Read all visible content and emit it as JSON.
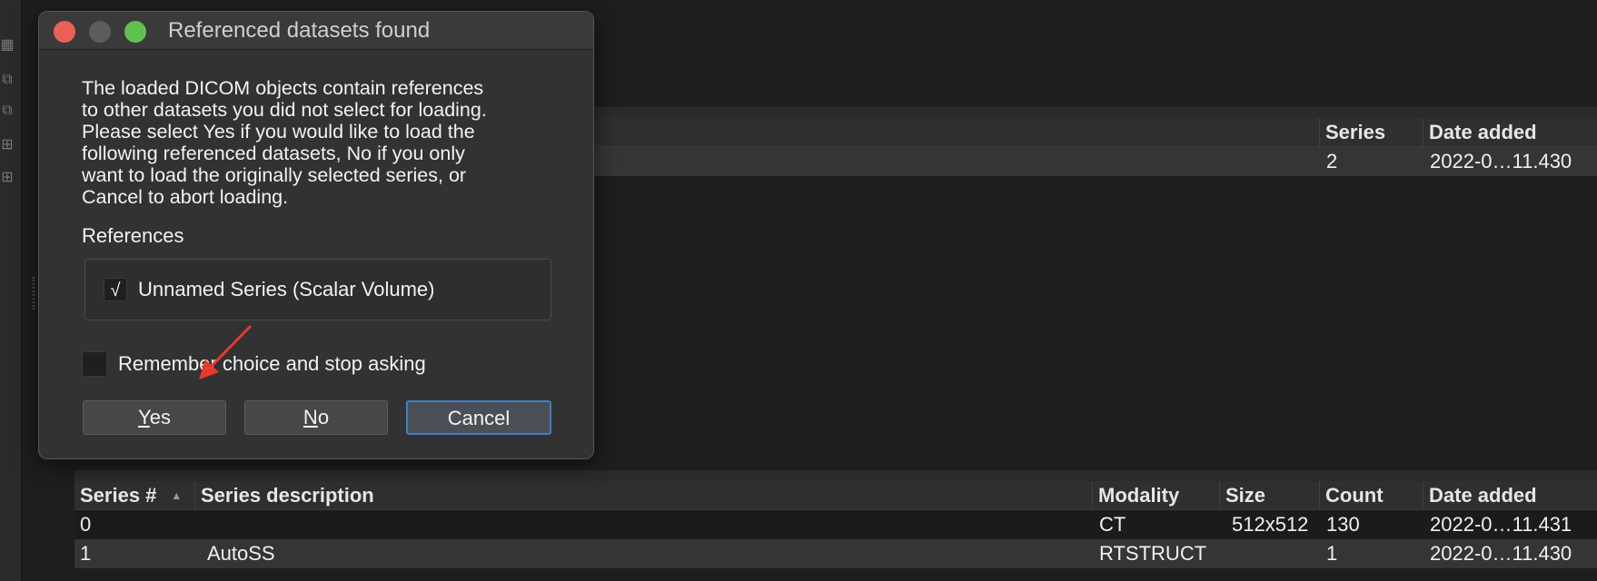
{
  "colors": {
    "background": "#1e1e1e",
    "dialog_background": "#323232",
    "close": "#ec5f57",
    "zoom": "#5fc24f",
    "default_button_border": "#3d80c7",
    "annotation_arrow": "#e8392f"
  },
  "left_toolbar": {
    "icons": [
      "grid-icon",
      "copy-icon",
      "copy-icon",
      "table-icon",
      "table-icon"
    ]
  },
  "top_table": {
    "columns": [
      "Series",
      "Date added"
    ],
    "rows": [
      {
        "series": "2",
        "date_added": "2022-0…11.430"
      }
    ]
  },
  "bottom_table": {
    "columns": [
      "Series #",
      "Series description",
      "Modality",
      "Size",
      "Count",
      "Date added"
    ],
    "sort_column": "Series #",
    "sort_direction": "ascending",
    "rows": [
      {
        "series_num": "0",
        "description": "",
        "modality": "CT",
        "size": "512x512",
        "count": "130",
        "date_added": "2022-0…11.431"
      },
      {
        "series_num": "1",
        "description": "AutoSS",
        "modality": "RTSTRUCT",
        "size": "",
        "count": "1",
        "date_added": "2022-0…11.430"
      }
    ]
  },
  "dialog": {
    "title": "Referenced datasets found",
    "message_lines": [
      "The loaded DICOM objects contain references",
      "to other datasets you did not select for loading.",
      "Please select Yes if you would like to load the",
      "following referenced datasets, No if you only",
      "want to load the originally selected series, or",
      "Cancel to abort loading."
    ],
    "references_label": "References",
    "references": [
      {
        "label": "Unnamed Series (Scalar Volume)",
        "checked": true,
        "check_glyph": "√"
      }
    ],
    "remember_label": "Remember choice and stop asking",
    "remember_checked": false,
    "buttons": {
      "yes": {
        "mnemonic": "Y",
        "rest": "es"
      },
      "no": {
        "mnemonic": "N",
        "rest": "o"
      },
      "cancel": {
        "label": "Cancel",
        "default": true
      }
    }
  }
}
